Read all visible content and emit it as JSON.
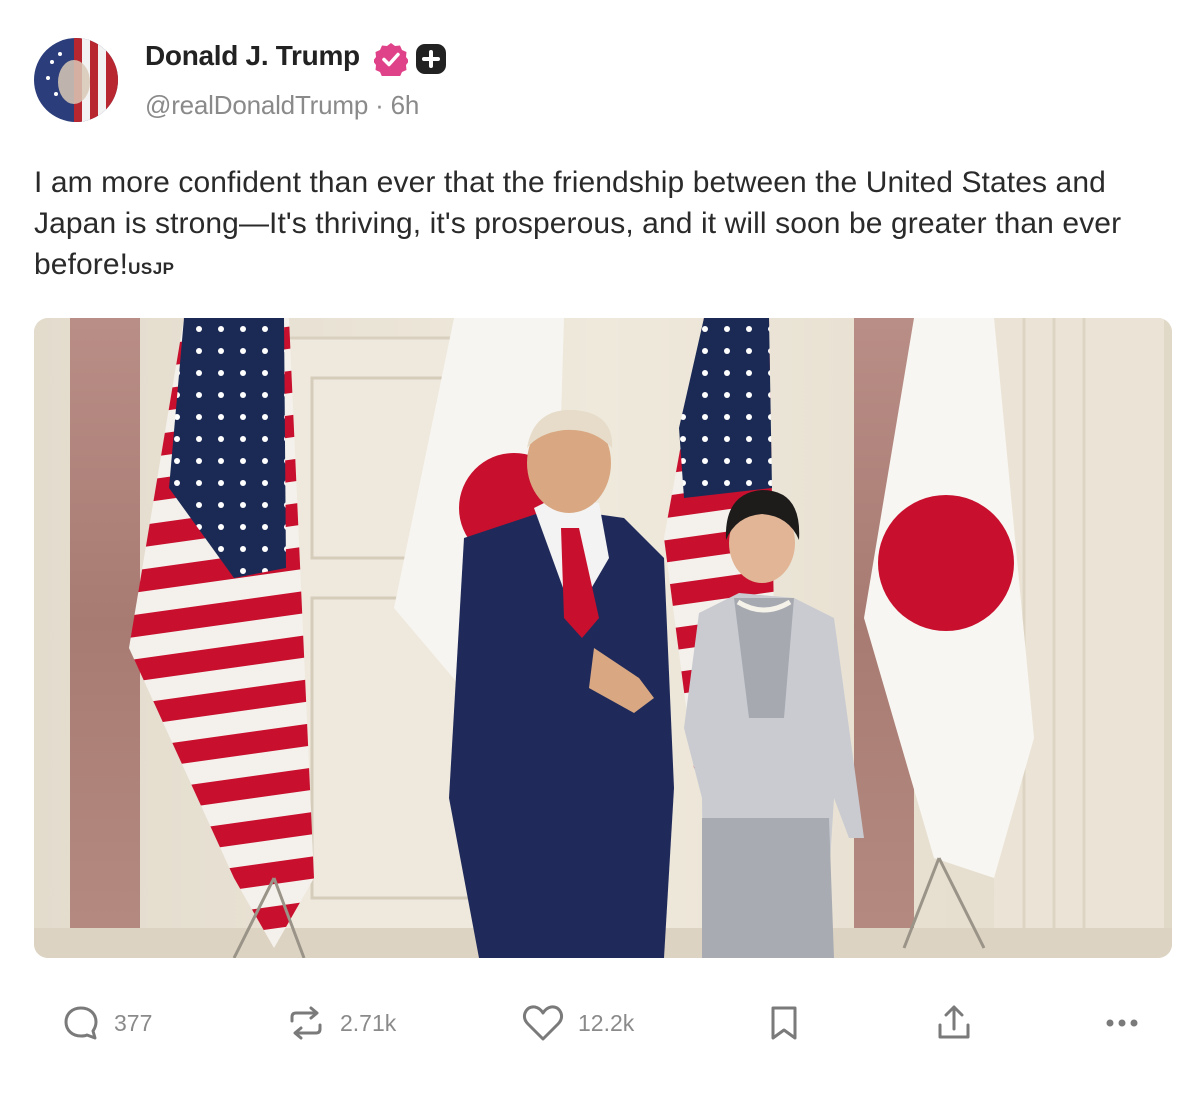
{
  "author": {
    "display_name": "Donald J. Trump",
    "handle": "@realDonaldTrump",
    "separator": "·",
    "time": "6h",
    "verified_icon": "verified-badge-icon",
    "plus_icon": "plus-badge-icon"
  },
  "post": {
    "text": "I am more confident than ever that the friendship between the United States and Japan is strong—It's thriving, it's prosperous, and it will soon be greater than ever before!",
    "tag": "USJP"
  },
  "colors": {
    "accent_pink": "#e0428a",
    "text": "#2a2a2a",
    "muted": "#8a8a8a",
    "suit_navy": "#1f2a5a",
    "flag_red": "#c8102e",
    "flag_blue": "#1b2a55"
  },
  "actions": {
    "reply": {
      "icon": "reply-icon",
      "count": "377"
    },
    "repost": {
      "icon": "repost-icon",
      "count": "2.71k"
    },
    "like": {
      "icon": "heart-icon",
      "count": "12.2k"
    },
    "bookmark": {
      "icon": "bookmark-icon"
    },
    "share": {
      "icon": "share-icon"
    },
    "more": {
      "icon": "more-icon"
    }
  }
}
